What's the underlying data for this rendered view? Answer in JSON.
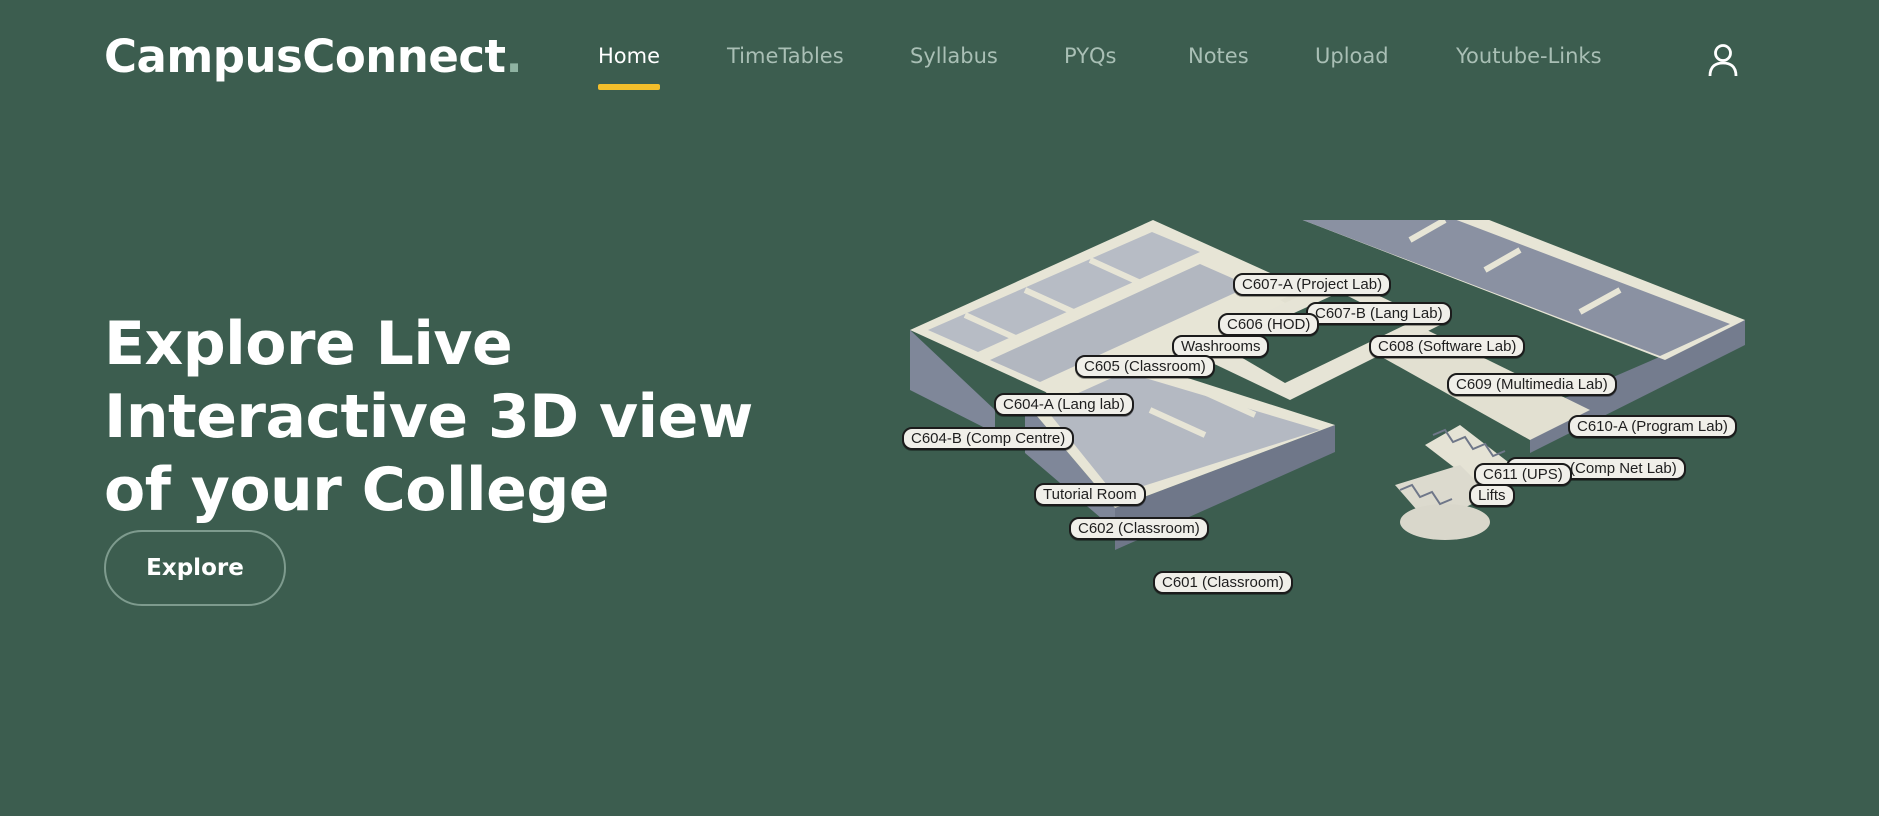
{
  "header": {
    "logo_text": "CampusConnect",
    "logo_dot": ".",
    "nav": [
      {
        "label": "Home",
        "active": true
      },
      {
        "label": "TimeTables"
      },
      {
        "label": "Syllabus"
      },
      {
        "label": "PYQs"
      },
      {
        "label": "Notes"
      },
      {
        "label": "Upload"
      },
      {
        "label": "Youtube-Links"
      }
    ],
    "user_icon": "user-icon"
  },
  "hero": {
    "title": "Explore Live Interactive 3D view of your College",
    "button_label": "Explore"
  },
  "map": {
    "labels": [
      "C607-A (Project Lab)",
      "C607-B (Lang Lab)",
      "C606 (HOD)",
      "Washrooms",
      "C608 (Software Lab)",
      "C605 (Classroom)",
      "C609 (Multimedia Lab)",
      "C604-A (Lang lab)",
      "C610-A (Program Lab)",
      "C604-B (Comp Centre)",
      "C610-B (Comp Net Lab)",
      "C611 (UPS)",
      "Lifts",
      "Tutorial Room",
      "C602 (Classroom)",
      "C601 (Classroom)"
    ]
  },
  "colors": {
    "background": "#3c5d4f",
    "accent": "#f3be2b",
    "nav_inactive": "#a9bfb5",
    "wall_top": "#e9e7d8",
    "wall_side": "#7f8799",
    "floor": "#b4b9c2"
  }
}
